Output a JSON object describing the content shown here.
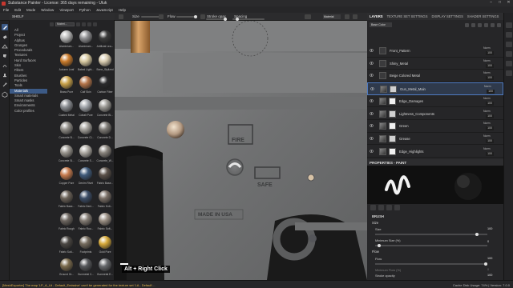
{
  "window": {
    "title": "Substance Painter - License: 365 days remaining - Uluk",
    "controls": [
      "–",
      "□",
      "✕"
    ]
  },
  "menu": [
    "File",
    "Edit",
    "Mode",
    "Window",
    "Viewport",
    "Python",
    "JavaScript",
    "Help"
  ],
  "toolbar": {
    "size_label": "Size",
    "flow_label": "Flow",
    "stroke_opacity_label": "Stroke opac",
    "spacing_label": "Spacing",
    "material_mode": "Material"
  },
  "shelf": {
    "title": "SHELF",
    "search": {
      "filter_label": "Materi..."
    },
    "categories": [
      "All",
      "Project",
      "Alphas",
      "Grunges",
      "Procedurals",
      "Textures",
      "Hard Surfaces",
      "Skin",
      "Filters",
      "Brushes",
      "Particles",
      "Tools",
      "Materials",
      "Smart materials",
      "Smart masks",
      "Environments",
      "Color profiles"
    ],
    "selected_category": "Materials",
    "materials": [
      {
        "name": "Aluminium...",
        "color": "#b8b8b8"
      },
      {
        "name": "Aluminium...",
        "color": "#8f8f92"
      },
      {
        "name": "Artificial Lea...",
        "color": "#3a3a3a"
      },
      {
        "name": "Autumn Leaf",
        "color": "#c97a2a"
      },
      {
        "name": "Baked Light...",
        "color": "#d8c9a0"
      },
      {
        "name": "Bone_Stylized",
        "color": "#d9ccb0"
      },
      {
        "name": "Brass Pure",
        "color": "#c9a24a"
      },
      {
        "name": "Calf Skin",
        "color": "#b5754a"
      },
      {
        "name": "Carbon Fiber",
        "color": "#2a2a2c"
      },
      {
        "name": "Coated Metal",
        "color": "#8a8d92"
      },
      {
        "name": "Cobalt Pure",
        "color": "#a3a7ad"
      },
      {
        "name": "Concrete Bl...",
        "color": "#9c9a95"
      },
      {
        "name": "Concrete B...",
        "color": "#8e8b85"
      },
      {
        "name": "Concrete Cl...",
        "color": "#a5a29c"
      },
      {
        "name": "Concrete D...",
        "color": "#7e7b76"
      },
      {
        "name": "Concrete Si...",
        "color": "#9a968f"
      },
      {
        "name": "Concrete S...",
        "color": "#b0aca5"
      },
      {
        "name": "Concrete_W...",
        "color": "#8a857e"
      },
      {
        "name": "Copper Pure",
        "color": "#c77b4e"
      },
      {
        "name": "Denim Rivet",
        "color": "#3f5a7a"
      },
      {
        "name": "Fabric Base...",
        "color": "#5a5048"
      },
      {
        "name": "Fabric Base...",
        "color": "#6b6258"
      },
      {
        "name": "Fabric Deni...",
        "color": "#3b4c66"
      },
      {
        "name": "Fabric Knit...",
        "color": "#7a6f66"
      },
      {
        "name": "Fabric Rough",
        "color": "#6d6660"
      },
      {
        "name": "Fabric Rou...",
        "color": "#837b73"
      },
      {
        "name": "Fabric Soft...",
        "color": "#9a8f84"
      },
      {
        "name": "Fabric Suit...",
        "color": "#4a4642"
      },
      {
        "name": "Footprints",
        "color": "#756b5d"
      },
      {
        "name": "Gold Pure",
        "color": "#d6a93a"
      },
      {
        "name": "Ground Gr...",
        "color": "#7a6a4c"
      },
      {
        "name": "Gunmetal C...",
        "color": "#55575a"
      },
      {
        "name": "Gunmetal E...",
        "color": "#66686b"
      }
    ]
  },
  "viewport": {
    "hint": "Alt + Right Click"
  },
  "right_panel": {
    "tabs": [
      "LAYERS",
      "TEXTURE SET SETTINGS",
      "DISPLAY SETTINGS",
      "SHADER SETTINGS"
    ],
    "active_tab": "LAYERS",
    "channel_dropdown": "Base Color",
    "layers": [
      {
        "name": "Front_Pattern",
        "blend": "Norm",
        "opacity": "100",
        "selected": false,
        "folder": true
      },
      {
        "name": "Shiny_Metal",
        "blend": "Norm",
        "opacity": "100",
        "selected": false,
        "folder": true
      },
      {
        "name": "Beige Colored Metal",
        "blend": "Norm",
        "opacity": "100",
        "selected": false,
        "folder": true
      },
      {
        "name": "Gun_Metal_Main",
        "blend": "Norm",
        "opacity": "100",
        "selected": true,
        "folder": false
      },
      {
        "name": "Edge_Damages",
        "blend": "Norm",
        "opacity": "100",
        "selected": false,
        "folder": false
      },
      {
        "name": "Lightness_Components",
        "blend": "Norm",
        "opacity": "100",
        "selected": false,
        "folder": false
      },
      {
        "name": "Green",
        "blend": "Norm",
        "opacity": "100",
        "selected": false,
        "folder": false
      },
      {
        "name": "Grease",
        "blend": "Norm",
        "opacity": "100",
        "selected": false,
        "folder": false
      },
      {
        "name": "Edge_Highlights",
        "blend": "Norm",
        "opacity": "100",
        "selected": false,
        "folder": false
      }
    ],
    "properties": {
      "title": "PROPERTIES - PAINT",
      "brush_section": "BRUSH",
      "size_section": "Size",
      "size_label": "Size",
      "size_value": "100",
      "size_fill": 0.92,
      "min_size_label": "Minimum Size (%)",
      "min_size_value": "0",
      "min_size_fill": 0.02,
      "flow_section": "Flow",
      "flow_label": "Flow",
      "flow_value": "100",
      "flow_fill": 1.0,
      "min_flow_label": "Minimum Flow (%)",
      "min_flow_value": "0",
      "min_flow_fill": 0.02,
      "stroke_opacity_label": "Stroke opacity",
      "stroke_opacity_value": "100",
      "stroke_opacity_fill": 1.0
    }
  },
  "status": {
    "message": "[MeshExporter] The map 'LP_A_Lit - Default_Emissive' can't be generated for the texture set 'LA - Default'...",
    "right": "Cache Disk Usage:  74% | Version: 7.0.0"
  },
  "colors": {
    "accent": "#4f7ac0",
    "warning": "#e6b84b",
    "panel": "#262628"
  }
}
